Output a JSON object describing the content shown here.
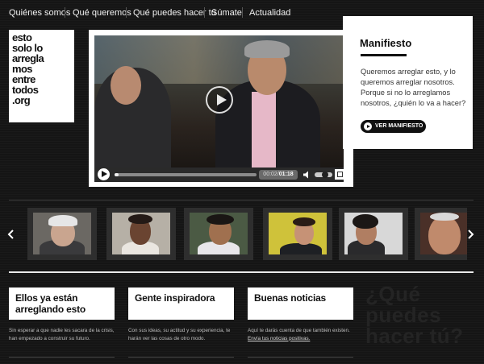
{
  "nav": {
    "items": [
      {
        "label": "Quiénes somos"
      },
      {
        "label": "Qué queremos"
      },
      {
        "label": "Qué puedes hacer tú"
      },
      {
        "label": "Súmate"
      },
      {
        "label": "Actualidad"
      }
    ]
  },
  "logo": {
    "text": "esto\nsolo lo\narregla\nmos\nentre\ntodos\n.org"
  },
  "video": {
    "time_current": "00:02",
    "time_separator": "/",
    "time_total": "01:18",
    "progress": 0.03,
    "volume": 0.6
  },
  "manifesto": {
    "title": "Manifiesto",
    "text": "Queremos arreglar esto, y lo queremos arreglar nosotros. Porque si no lo arreglamos nosotros, ¿quién lo va a hacer?",
    "button_label": "VER MANIFIESTO"
  },
  "cards": [
    {
      "title": "Ellos ya están arreglando esto",
      "desc": "Sin esperar a que nadie les sacara de la crisis, han empezado a construir su futuro.",
      "link": ""
    },
    {
      "title": "Gente inspiradora",
      "desc": "Con sus ideas, su actitud y su experiencia, te harán ver las cosas de otro modo.",
      "link": ""
    },
    {
      "title": "Buenas noticias",
      "desc": "Aquí te darás cuenta de que también existen.",
      "link": "Envía tus noticias positivas."
    }
  ],
  "question": "¿Qué\npuedes\nhacer tú?",
  "colors": {
    "background": "#151515",
    "panel": "#ffffff",
    "accent_text": "#111111"
  }
}
